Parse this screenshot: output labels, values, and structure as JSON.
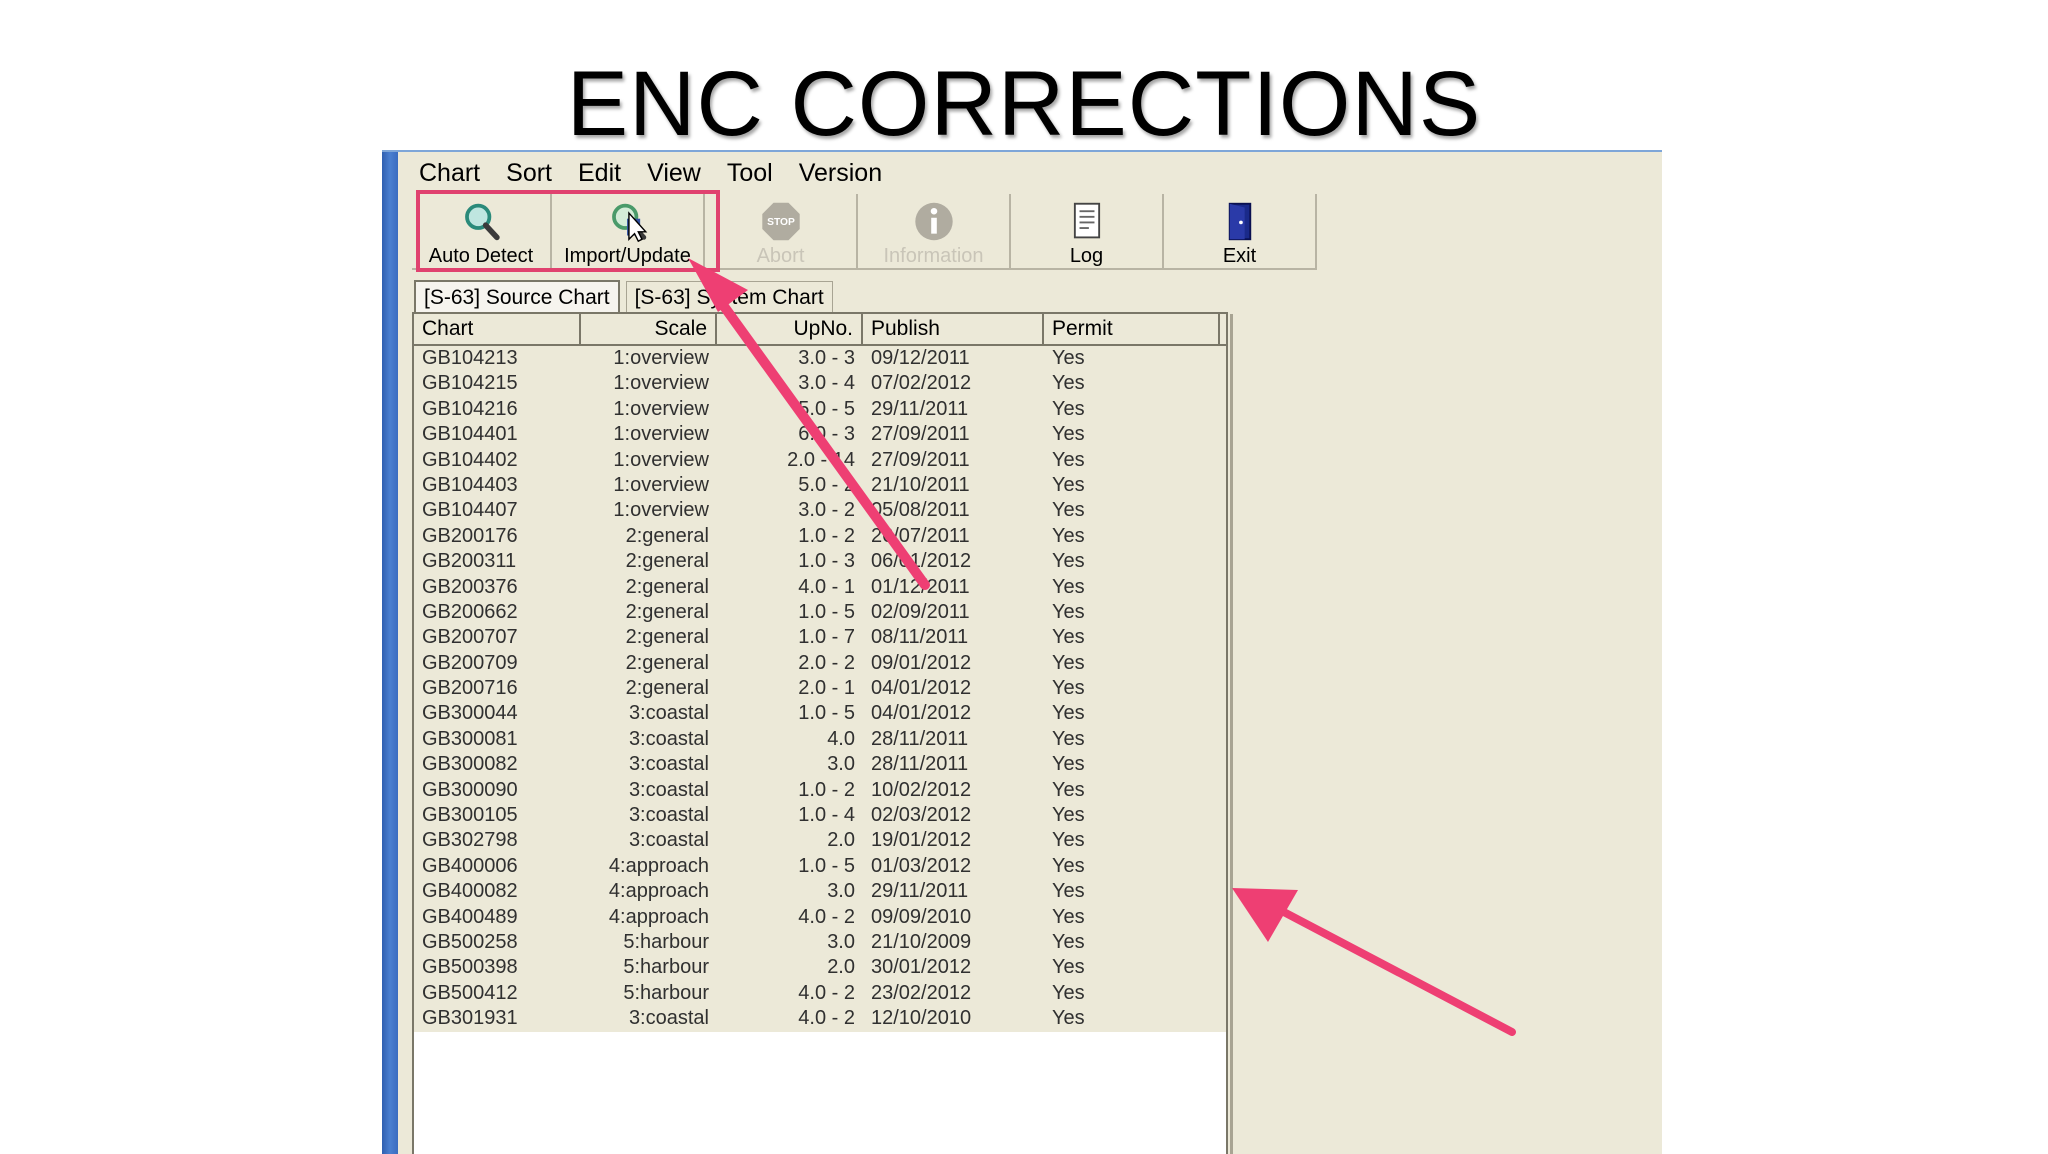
{
  "slide": {
    "title": "ENC CORRECTIONS"
  },
  "menu": [
    "Chart",
    "Sort",
    "Edit",
    "View",
    "Tool",
    "Version"
  ],
  "toolbar": {
    "auto_detect": "Auto Detect",
    "import_update": "Import/Update",
    "abort": "Abort",
    "information": "Information",
    "log": "Log",
    "exit": "Exit"
  },
  "tabs": {
    "source": "[S-63] Source Chart",
    "system": "[S-63] System Chart"
  },
  "table": {
    "headers": [
      "Chart",
      "Scale",
      "UpNo.",
      "Publish",
      "Permit"
    ],
    "rows": [
      [
        "GB104213",
        "1:overview",
        "3.0 - 3",
        "09/12/2011",
        "Yes"
      ],
      [
        "GB104215",
        "1:overview",
        "3.0 - 4",
        "07/02/2012",
        "Yes"
      ],
      [
        "GB104216",
        "1:overview",
        "5.0 - 5",
        "29/11/2011",
        "Yes"
      ],
      [
        "GB104401",
        "1:overview",
        "6.0 - 3",
        "27/09/2011",
        "Yes"
      ],
      [
        "GB104402",
        "1:overview",
        "2.0 - 14",
        "27/09/2011",
        "Yes"
      ],
      [
        "GB104403",
        "1:overview",
        "5.0 - 2",
        "21/10/2011",
        "Yes"
      ],
      [
        "GB104407",
        "1:overview",
        "3.0 - 2",
        "05/08/2011",
        "Yes"
      ],
      [
        "GB200176",
        "2:general",
        "1.0 - 2",
        "26/07/2011",
        "Yes"
      ],
      [
        "GB200311",
        "2:general",
        "1.0 - 3",
        "06/01/2012",
        "Yes"
      ],
      [
        "GB200376",
        "2:general",
        "4.0 - 1",
        "01/12/2011",
        "Yes"
      ],
      [
        "GB200662",
        "2:general",
        "1.0 - 5",
        "02/09/2011",
        "Yes"
      ],
      [
        "GB200707",
        "2:general",
        "1.0 - 7",
        "08/11/2011",
        "Yes"
      ],
      [
        "GB200709",
        "2:general",
        "2.0 - 2",
        "09/01/2012",
        "Yes"
      ],
      [
        "GB200716",
        "2:general",
        "2.0 - 1",
        "04/01/2012",
        "Yes"
      ],
      [
        "GB300044",
        "3:coastal",
        "1.0 - 5",
        "04/01/2012",
        "Yes"
      ],
      [
        "GB300081",
        "3:coastal",
        "4.0",
        "28/11/2011",
        "Yes"
      ],
      [
        "GB300082",
        "3:coastal",
        "3.0",
        "28/11/2011",
        "Yes"
      ],
      [
        "GB300090",
        "3:coastal",
        "1.0 - 2",
        "10/02/2012",
        "Yes"
      ],
      [
        "GB300105",
        "3:coastal",
        "1.0 - 4",
        "02/03/2012",
        "Yes"
      ],
      [
        "GB302798",
        "3:coastal",
        "2.0",
        "19/01/2012",
        "Yes"
      ],
      [
        "GB400006",
        "4:approach",
        "1.0 - 5",
        "01/03/2012",
        "Yes"
      ],
      [
        "GB400082",
        "4:approach",
        "3.0",
        "29/11/2011",
        "Yes"
      ],
      [
        "GB400489",
        "4:approach",
        "4.0 - 2",
        "09/09/2010",
        "Yes"
      ],
      [
        "GB500258",
        "5:harbour",
        "3.0",
        "21/10/2009",
        "Yes"
      ],
      [
        "GB500398",
        "5:harbour",
        "2.0",
        "30/01/2012",
        "Yes"
      ],
      [
        "GB500412",
        "5:harbour",
        "4.0 - 2",
        "23/02/2012",
        "Yes"
      ],
      [
        "GB301931",
        "3:coastal",
        "4.0 - 2",
        "12/10/2010",
        "Yes"
      ]
    ]
  },
  "colors": {
    "accent": "#e0426f",
    "window_bg": "#ece9d8",
    "title_bar": "#3a6cc0"
  }
}
